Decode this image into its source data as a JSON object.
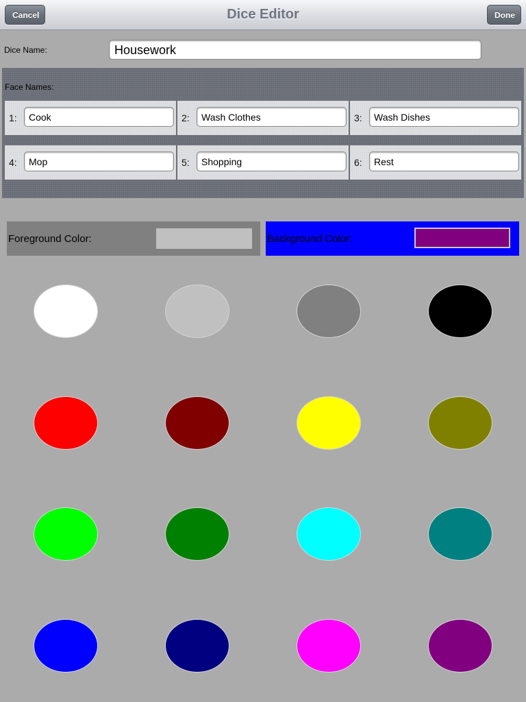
{
  "navbar": {
    "title": "Dice Editor",
    "cancel_label": "Cancel",
    "done_label": "Done"
  },
  "dice": {
    "name_label": "Dice Name:",
    "name_value": "Housework"
  },
  "faces": {
    "label": "Face Names:",
    "items": [
      {
        "num": "1:",
        "value": "Cook"
      },
      {
        "num": "2:",
        "value": "Wash Clothes"
      },
      {
        "num": "3:",
        "value": "Wash Dishes"
      },
      {
        "num": "4:",
        "value": "Mop"
      },
      {
        "num": "5:",
        "value": "Shopping"
      },
      {
        "num": "6:",
        "value": "Rest"
      }
    ]
  },
  "colors": {
    "foreground_label": "Foreground Color:",
    "foreground_value": "#c0c0c0",
    "background_label": "Background Color:",
    "background_value": "#800080",
    "background_box_color": "#0000ff",
    "foreground_box_color": "#808080"
  },
  "palette": [
    "#ffffff",
    "#c0c0c0",
    "#808080",
    "#000000",
    "#ff0000",
    "#800000",
    "#ffff00",
    "#808000",
    "#00ff00",
    "#008000",
    "#00ffff",
    "#008080",
    "#0000ff",
    "#000080",
    "#ff00ff",
    "#800080"
  ]
}
